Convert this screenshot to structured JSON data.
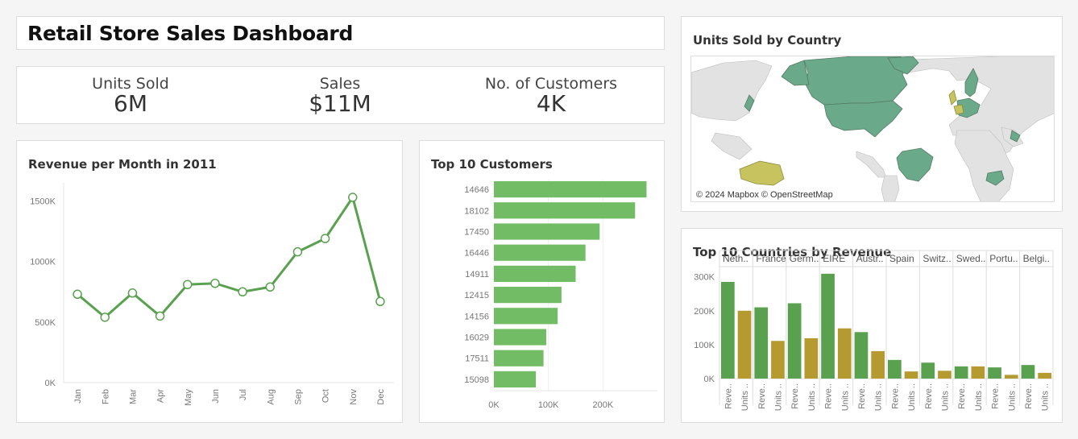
{
  "dashboard": {
    "title": "Retail Store Sales Dashboard"
  },
  "kpis": [
    {
      "label": "Units Sold",
      "value": "6M"
    },
    {
      "label": "Sales",
      "value": "$11M"
    },
    {
      "label": "No. of Customers",
      "value": "4K"
    }
  ],
  "map": {
    "title": "Units Sold by Country",
    "attribution": "© 2024 Mapbox © OpenStreetMap",
    "colors": {
      "high": "#6aa98a",
      "mid": "#c7c460",
      "none": "#e2e2e2",
      "border": "#9a9a9a"
    }
  },
  "colors": {
    "green": "#59a14f",
    "green_light": "#73bc66",
    "gold": "#b59a30"
  },
  "chart_data": [
    {
      "type": "line",
      "title": "Revenue per Month in 2011",
      "categories": [
        "Jan",
        "Feb",
        "Mar",
        "Apr",
        "May",
        "Jun",
        "Jul",
        "Aug",
        "Sep",
        "Oct",
        "Nov",
        "Dec"
      ],
      "values": [
        730000,
        540000,
        740000,
        550000,
        810000,
        820000,
        750000,
        790000,
        1080000,
        1190000,
        1530000,
        670000
      ],
      "yticks": [
        0,
        500000,
        1000000,
        1500000
      ],
      "yticklabels": [
        "0K",
        "500K",
        "1000K",
        "1500K"
      ],
      "ylim": [
        0,
        1650000
      ]
    },
    {
      "type": "bar",
      "orientation": "horizontal",
      "title": "Top 10 Customers",
      "categories": [
        "14646",
        "18102",
        "17450",
        "16446",
        "14911",
        "12415",
        "14156",
        "16029",
        "17511",
        "15098"
      ],
      "values": [
        280000,
        259000,
        194000,
        168000,
        150000,
        124000,
        117000,
        96000,
        91000,
        77000
      ],
      "xticks": [
        0,
        100000,
        200000
      ],
      "xticklabels": [
        "0K",
        "100K",
        "200K"
      ],
      "xlim": [
        0,
        300000
      ]
    },
    {
      "type": "bar",
      "title": "Top 10 Countries by Revenue",
      "categories": [
        "Neth..",
        "France",
        "Germ..",
        "EIRE",
        "Austr..",
        "Spain",
        "Switz..",
        "Swed..",
        "Portu..",
        "Belgi.."
      ],
      "series": [
        {
          "name": "Reve..",
          "values": [
            285000,
            210000,
            222000,
            309000,
            137000,
            55000,
            47000,
            36000,
            33000,
            40000
          ]
        },
        {
          "name": "Units ..",
          "values": [
            200000,
            111000,
            119000,
            148000,
            81000,
            21000,
            23000,
            36000,
            11000,
            17000
          ]
        }
      ],
      "yticks": [
        0,
        100000,
        200000,
        300000
      ],
      "yticklabels": [
        "0K",
        "100K",
        "200K",
        "300K"
      ],
      "ylim": [
        0,
        330000
      ]
    }
  ]
}
